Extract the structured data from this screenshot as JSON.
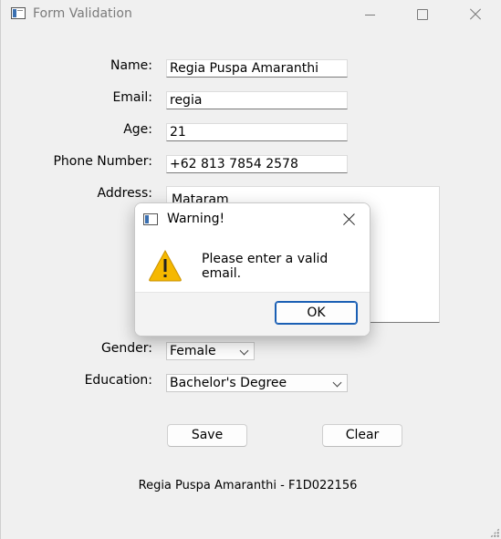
{
  "window": {
    "title": "Form Validation"
  },
  "form": {
    "name_label": "Name:",
    "name_value": "Regia Puspa Amaranthi",
    "email_label": "Email:",
    "email_value": "regia",
    "age_label": "Age:",
    "age_value": "21",
    "phone_label": "Phone Number:",
    "phone_value": "+62 813 7854 2578",
    "address_label": "Address:",
    "address_value": "Mataram",
    "gender_label": "Gender:",
    "gender_value": "Female",
    "education_label": "Education:",
    "education_value": "Bachelor's Degree",
    "save_label": "Save",
    "clear_label": "Clear"
  },
  "footer": {
    "credit": "Regia Puspa Amaranthi - F1D022156"
  },
  "dialog": {
    "title": "Warning!",
    "message": "Please enter a valid email.",
    "ok_label": "OK",
    "icon": "warning-icon",
    "warning_color": "#f5b800"
  }
}
